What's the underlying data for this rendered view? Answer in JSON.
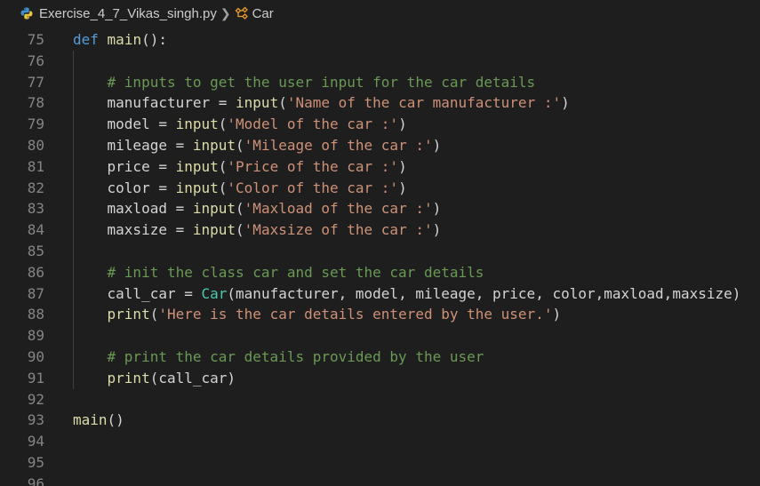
{
  "breadcrumb": {
    "file": "Exercise_4_7_Vikas_singh.py",
    "symbol": "Car",
    "file_icon": "python-icon",
    "symbol_icon": "class-icon"
  },
  "lines": [
    {
      "n": "75",
      "tokens": [
        {
          "t": "def",
          "c": "kw"
        },
        {
          "t": " "
        },
        {
          "t": "main",
          "c": "fn"
        },
        {
          "t": "():"
        }
      ]
    },
    {
      "n": "76",
      "tokens": [],
      "guide": true
    },
    {
      "n": "77",
      "tokens": [
        {
          "t": "    "
        },
        {
          "t": "# inputs to get the user input for the car details",
          "c": "cm"
        }
      ],
      "guide": true
    },
    {
      "n": "78",
      "tokens": [
        {
          "t": "    manufacturer = "
        },
        {
          "t": "input",
          "c": "fn"
        },
        {
          "t": "("
        },
        {
          "t": "'Name of the car manufacturer :'",
          "c": "st"
        },
        {
          "t": ")"
        }
      ],
      "guide": true
    },
    {
      "n": "79",
      "tokens": [
        {
          "t": "    model = "
        },
        {
          "t": "input",
          "c": "fn"
        },
        {
          "t": "("
        },
        {
          "t": "'Model of the car :'",
          "c": "st"
        },
        {
          "t": ")"
        }
      ],
      "guide": true
    },
    {
      "n": "80",
      "tokens": [
        {
          "t": "    mileage = "
        },
        {
          "t": "input",
          "c": "fn"
        },
        {
          "t": "("
        },
        {
          "t": "'Mileage of the car :'",
          "c": "st"
        },
        {
          "t": ")"
        }
      ],
      "guide": true
    },
    {
      "n": "81",
      "tokens": [
        {
          "t": "    price = "
        },
        {
          "t": "input",
          "c": "fn"
        },
        {
          "t": "("
        },
        {
          "t": "'Price of the car :'",
          "c": "st"
        },
        {
          "t": ")"
        }
      ],
      "guide": true
    },
    {
      "n": "82",
      "tokens": [
        {
          "t": "    color = "
        },
        {
          "t": "input",
          "c": "fn"
        },
        {
          "t": "("
        },
        {
          "t": "'Color of the car :'",
          "c": "st"
        },
        {
          "t": ")"
        }
      ],
      "guide": true
    },
    {
      "n": "83",
      "tokens": [
        {
          "t": "    maxload = "
        },
        {
          "t": "input",
          "c": "fn"
        },
        {
          "t": "("
        },
        {
          "t": "'Maxload of the car :'",
          "c": "st"
        },
        {
          "t": ")"
        }
      ],
      "guide": true
    },
    {
      "n": "84",
      "tokens": [
        {
          "t": "    maxsize = "
        },
        {
          "t": "input",
          "c": "fn"
        },
        {
          "t": "("
        },
        {
          "t": "'Maxsize of the car :'",
          "c": "st"
        },
        {
          "t": ")"
        }
      ],
      "guide": true
    },
    {
      "n": "85",
      "tokens": [],
      "guide": true
    },
    {
      "n": "86",
      "tokens": [
        {
          "t": "    "
        },
        {
          "t": "# init the class car and set the car details",
          "c": "cm"
        }
      ],
      "guide": true
    },
    {
      "n": "87",
      "tokens": [
        {
          "t": "    call_car = "
        },
        {
          "t": "Car",
          "c": "cls"
        },
        {
          "t": "(manufacturer, model, mileage, price, color,maxload,maxsize)"
        }
      ],
      "guide": true
    },
    {
      "n": "88",
      "tokens": [
        {
          "t": "    "
        },
        {
          "t": "print",
          "c": "fn"
        },
        {
          "t": "("
        },
        {
          "t": "'Here is the car details entered by the user.'",
          "c": "st"
        },
        {
          "t": ")"
        }
      ],
      "guide": true
    },
    {
      "n": "89",
      "tokens": [],
      "guide": true
    },
    {
      "n": "90",
      "tokens": [
        {
          "t": "    "
        },
        {
          "t": "# print the car details provided by the user",
          "c": "cm"
        }
      ],
      "guide": true
    },
    {
      "n": "91",
      "tokens": [
        {
          "t": "    "
        },
        {
          "t": "print",
          "c": "fn"
        },
        {
          "t": "(call_car)"
        }
      ],
      "guide": true
    },
    {
      "n": "92",
      "tokens": []
    },
    {
      "n": "93",
      "tokens": [
        {
          "t": "main",
          "c": "fn"
        },
        {
          "t": "()"
        }
      ]
    },
    {
      "n": "94",
      "tokens": []
    },
    {
      "n": "95",
      "tokens": []
    },
    {
      "n": "96",
      "tokens": []
    }
  ]
}
